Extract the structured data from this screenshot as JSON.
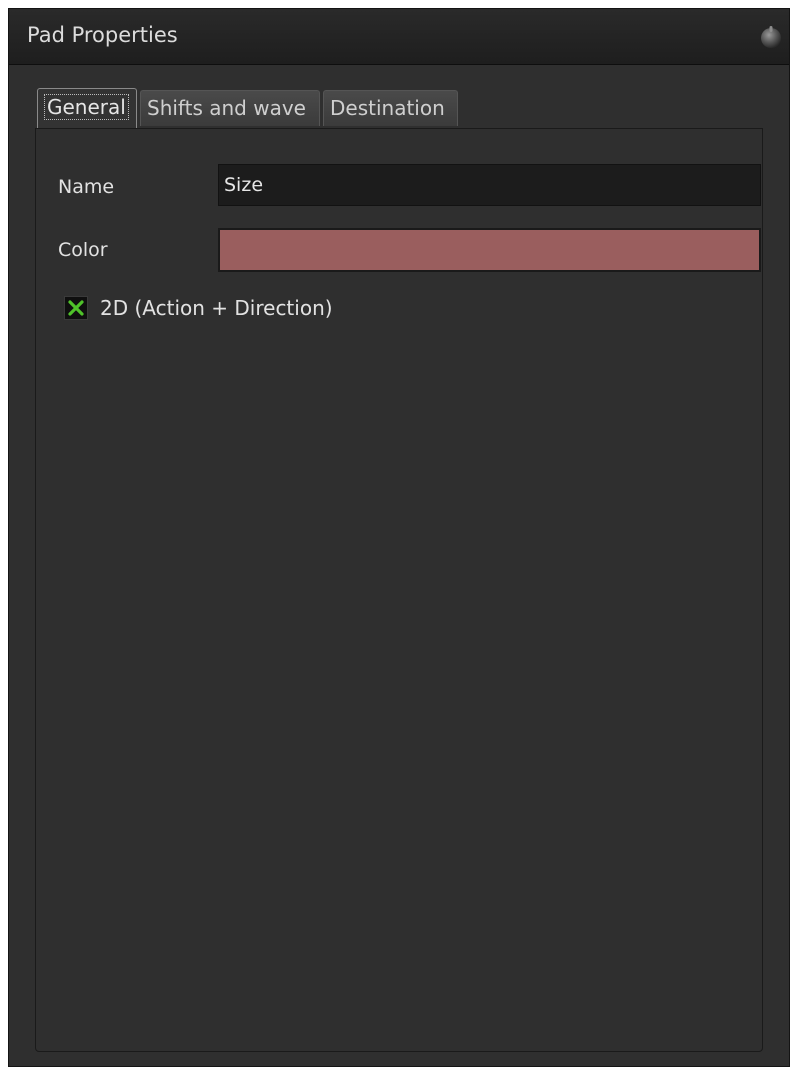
{
  "window": {
    "title": "Pad Properties",
    "title_icon": "round-knob-icon"
  },
  "tabs": [
    {
      "label": "General",
      "active": true
    },
    {
      "label": "Shifts and wave",
      "active": false
    },
    {
      "label": "Destination",
      "active": false
    }
  ],
  "general": {
    "name_label": "Name",
    "name_value": "Size",
    "color_label": "Color",
    "color_value": "#9a5e5e",
    "checkbox_label": "2D (Action + Direction)",
    "checkbox_checked": true,
    "checkbox_icon": "x-mark-icon",
    "checkbox_accent": "#4fc22a"
  }
}
